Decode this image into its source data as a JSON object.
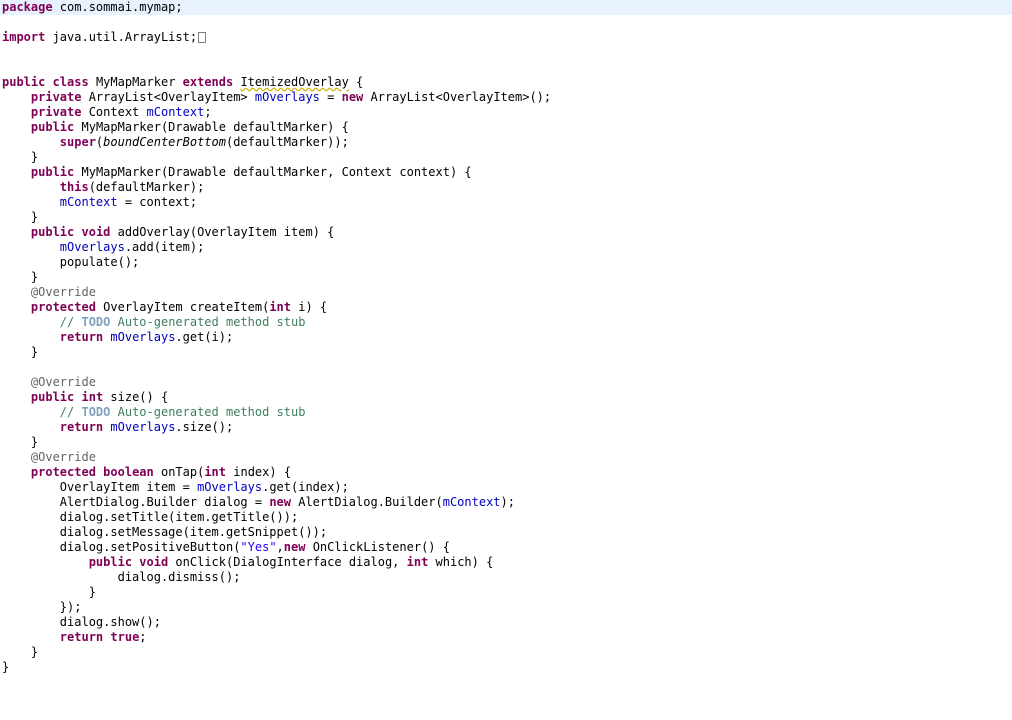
{
  "editor": {
    "language": "Java",
    "current_line_index": 0,
    "lines": [
      [
        {
          "t": "package",
          "c": "kw"
        },
        {
          "t": " com.sommai.mymap;"
        }
      ],
      [],
      [
        {
          "t": "import",
          "c": "kw"
        },
        {
          "t": " java.util.ArrayList;"
        },
        {
          "fold": true
        }
      ],
      [],
      [],
      [
        {
          "t": "public",
          "c": "kw"
        },
        {
          "t": " "
        },
        {
          "t": "class",
          "c": "kw"
        },
        {
          "t": " MyMapMarker "
        },
        {
          "t": "extends",
          "c": "kw"
        },
        {
          "t": " "
        },
        {
          "t": "ItemizedOverlay",
          "c": "warn-ul"
        },
        {
          "t": " {"
        }
      ],
      [
        {
          "t": "    "
        },
        {
          "t": "private",
          "c": "kw"
        },
        {
          "t": " ArrayList<OverlayItem> "
        },
        {
          "t": "mOverlays",
          "c": "fld"
        },
        {
          "t": " = "
        },
        {
          "t": "new",
          "c": "kw"
        },
        {
          "t": " ArrayList<OverlayItem>();"
        }
      ],
      [
        {
          "t": "    "
        },
        {
          "t": "private",
          "c": "kw"
        },
        {
          "t": " Context "
        },
        {
          "t": "mContext",
          "c": "fld"
        },
        {
          "t": ";"
        }
      ],
      [
        {
          "t": "    "
        },
        {
          "t": "public",
          "c": "kw"
        },
        {
          "t": " MyMapMarker(Drawable defaultMarker) {"
        }
      ],
      [
        {
          "t": "        "
        },
        {
          "t": "super",
          "c": "kw"
        },
        {
          "t": "("
        },
        {
          "t": "boundCenterBottom",
          "c": "it"
        },
        {
          "t": "(defaultMarker));"
        }
      ],
      [
        {
          "t": "    }"
        }
      ],
      [
        {
          "t": "    "
        },
        {
          "t": "public",
          "c": "kw"
        },
        {
          "t": " MyMapMarker(Drawable defaultMarker, Context context) {"
        }
      ],
      [
        {
          "t": "        "
        },
        {
          "t": "this",
          "c": "kw"
        },
        {
          "t": "(defaultMarker);"
        }
      ],
      [
        {
          "t": "        "
        },
        {
          "t": "mContext",
          "c": "fld"
        },
        {
          "t": " = context;"
        }
      ],
      [
        {
          "t": "    }"
        }
      ],
      [
        {
          "t": "    "
        },
        {
          "t": "public",
          "c": "kw"
        },
        {
          "t": " "
        },
        {
          "t": "void",
          "c": "kw"
        },
        {
          "t": " addOverlay(OverlayItem item) {"
        }
      ],
      [
        {
          "t": "        "
        },
        {
          "t": "mOverlays",
          "c": "fld"
        },
        {
          "t": ".add(item);"
        }
      ],
      [
        {
          "t": "        populate();"
        }
      ],
      [
        {
          "t": "    }"
        }
      ],
      [
        {
          "t": "    "
        },
        {
          "t": "@Override",
          "c": "ann"
        }
      ],
      [
        {
          "t": "    "
        },
        {
          "t": "protected",
          "c": "kw"
        },
        {
          "t": " OverlayItem createItem("
        },
        {
          "t": "int",
          "c": "kw"
        },
        {
          "t": " i) {"
        }
      ],
      [
        {
          "t": "        "
        },
        {
          "t": "// ",
          "c": "cmt"
        },
        {
          "t": "TODO",
          "c": "todo"
        },
        {
          "t": " Auto-generated method stub",
          "c": "cmt"
        }
      ],
      [
        {
          "t": "        "
        },
        {
          "t": "return",
          "c": "kw"
        },
        {
          "t": " "
        },
        {
          "t": "mOverlays",
          "c": "fld"
        },
        {
          "t": ".get(i);"
        }
      ],
      [
        {
          "t": "    }"
        }
      ],
      [],
      [
        {
          "t": "    "
        },
        {
          "t": "@Override",
          "c": "ann"
        }
      ],
      [
        {
          "t": "    "
        },
        {
          "t": "public",
          "c": "kw"
        },
        {
          "t": " "
        },
        {
          "t": "int",
          "c": "kw"
        },
        {
          "t": " size() {"
        }
      ],
      [
        {
          "t": "        "
        },
        {
          "t": "// ",
          "c": "cmt"
        },
        {
          "t": "TODO",
          "c": "todo"
        },
        {
          "t": " Auto-generated method stub",
          "c": "cmt"
        }
      ],
      [
        {
          "t": "        "
        },
        {
          "t": "return",
          "c": "kw"
        },
        {
          "t": " "
        },
        {
          "t": "mOverlays",
          "c": "fld"
        },
        {
          "t": ".size();"
        }
      ],
      [
        {
          "t": "    }"
        }
      ],
      [
        {
          "t": "    "
        },
        {
          "t": "@Override",
          "c": "ann"
        }
      ],
      [
        {
          "t": "    "
        },
        {
          "t": "protected",
          "c": "kw"
        },
        {
          "t": " "
        },
        {
          "t": "boolean",
          "c": "kw"
        },
        {
          "t": " onTap("
        },
        {
          "t": "int",
          "c": "kw"
        },
        {
          "t": " index) {"
        }
      ],
      [
        {
          "t": "        OverlayItem item = "
        },
        {
          "t": "mOverlays",
          "c": "fld"
        },
        {
          "t": ".get(index);"
        }
      ],
      [
        {
          "t": "        AlertDialog.Builder dialog = "
        },
        {
          "t": "new",
          "c": "kw"
        },
        {
          "t": " AlertDialog.Builder("
        },
        {
          "t": "mContext",
          "c": "fld"
        },
        {
          "t": ");"
        }
      ],
      [
        {
          "t": "        dialog.setTitle(item.getTitle());"
        }
      ],
      [
        {
          "t": "        dialog.setMessage(item.getSnippet());"
        }
      ],
      [
        {
          "t": "        dialog.setPositiveButton("
        },
        {
          "t": "\"Yes\"",
          "c": "str"
        },
        {
          "t": ","
        },
        {
          "t": "new",
          "c": "kw"
        },
        {
          "t": " OnClickListener() {"
        }
      ],
      [
        {
          "t": "            "
        },
        {
          "t": "public",
          "c": "kw"
        },
        {
          "t": " "
        },
        {
          "t": "void",
          "c": "kw"
        },
        {
          "t": " onClick(DialogInterface dialog, "
        },
        {
          "t": "int",
          "c": "kw"
        },
        {
          "t": " which) {"
        }
      ],
      [
        {
          "t": "                dialog.dismiss();"
        }
      ],
      [
        {
          "t": "            }"
        }
      ],
      [
        {
          "t": "        });"
        }
      ],
      [
        {
          "t": "        dialog.show();"
        }
      ],
      [
        {
          "t": "        "
        },
        {
          "t": "return",
          "c": "kw"
        },
        {
          "t": " "
        },
        {
          "t": "true",
          "c": "kw"
        },
        {
          "t": ";"
        }
      ],
      [
        {
          "t": "    }"
        }
      ],
      [
        {
          "t": "}"
        }
      ]
    ]
  },
  "colors": {
    "keyword": "#7f0055",
    "field": "#0000c0",
    "comment": "#3f7f5f",
    "todo_tag": "#7f9fbf",
    "annotation": "#646464",
    "string": "#2a00ff",
    "current_line_highlight": "#e8f2fe",
    "warning_underline": "#d4b200"
  }
}
